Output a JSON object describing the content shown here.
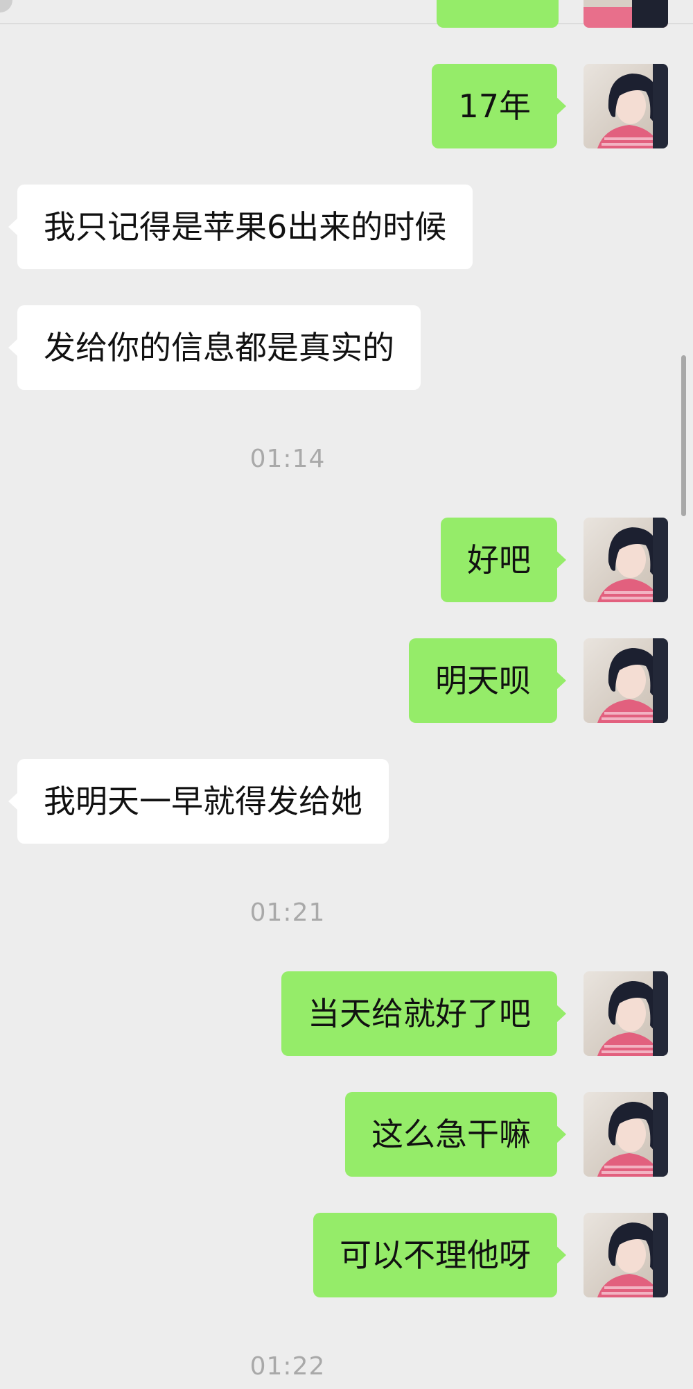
{
  "conversation": {
    "messages": [
      {
        "id": "m1",
        "side": "out",
        "text": "17年"
      },
      {
        "id": "m2",
        "side": "in",
        "text": "我只记得是苹果6出来的时候"
      },
      {
        "id": "m3",
        "side": "in",
        "text": "发给你的信息都是真实的"
      },
      {
        "id": "t1",
        "type": "time",
        "text": "01:14"
      },
      {
        "id": "m4",
        "side": "out",
        "text": "好吧"
      },
      {
        "id": "m5",
        "side": "out",
        "text": "明天呗"
      },
      {
        "id": "m6",
        "side": "in",
        "text": "我明天一早就得发给她"
      },
      {
        "id": "t2",
        "type": "time",
        "text": "01:21"
      },
      {
        "id": "m7",
        "side": "out",
        "text": "当天给就好了吧"
      },
      {
        "id": "m8",
        "side": "out",
        "text": "这么急干嘛"
      },
      {
        "id": "m9",
        "side": "out",
        "text": "可以不理他呀"
      },
      {
        "id": "t3",
        "type": "time",
        "text": "01:22"
      }
    ]
  },
  "colors": {
    "background": "#ededed",
    "outgoing_bubble": "#95ec69",
    "incoming_bubble": "#ffffff",
    "timestamp_text": "#a9a9a9"
  },
  "icons": {
    "self_avatar": "user-avatar-photo"
  }
}
